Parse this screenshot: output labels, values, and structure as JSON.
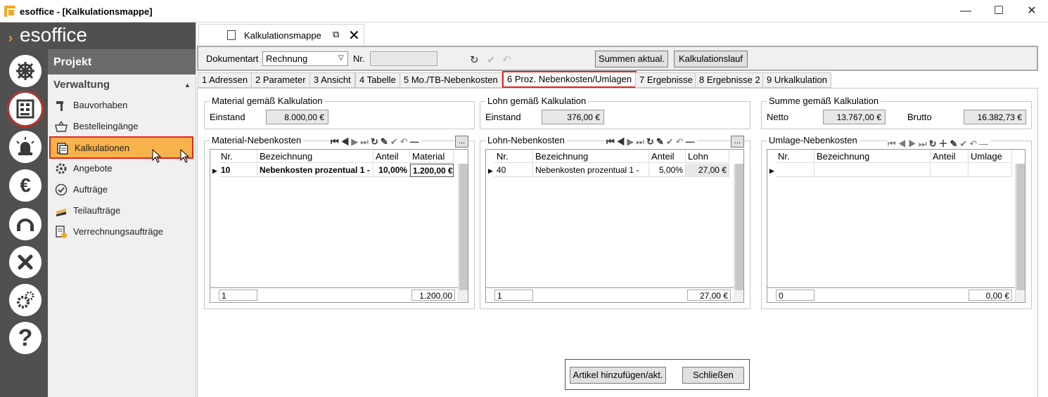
{
  "window": {
    "title": "esoffice - [Kalkulationsmappe]",
    "minimize": "—",
    "maximize": "☐",
    "close": "✕"
  },
  "brand": {
    "logo": "esoffice"
  },
  "sidebar": {
    "header": "Projekt",
    "section": "Verwaltung",
    "items": [
      {
        "label": "Bauvorhaben",
        "icon": "hammer-icon"
      },
      {
        "label": "Bestelleingänge",
        "icon": "basket-icon"
      },
      {
        "label": "Kalkulationen",
        "icon": "calculation-doc-icon",
        "active": true
      },
      {
        "label": "Angebote",
        "icon": "gear-icon"
      },
      {
        "label": "Aufträge",
        "icon": "check-circle-icon"
      },
      {
        "label": "Teilaufträge",
        "icon": "layers-icon"
      },
      {
        "label": "Verrechnungsaufträge",
        "icon": "doc-coin-icon"
      }
    ]
  },
  "doc_tab": {
    "label": "Kalkulationsmappe"
  },
  "toolbar": {
    "dokart_label": "Dokumentart",
    "dokart_value": "Rechnung",
    "nr_label": "Nr.",
    "nr_value": "",
    "summen_btn": "Summen aktual.",
    "lauf_btn": "Kalkulationslauf"
  },
  "tabs": [
    {
      "label": "1 Adressen"
    },
    {
      "label": "2 Parameter"
    },
    {
      "label": "3 Ansicht"
    },
    {
      "label": "4 Tabelle"
    },
    {
      "label": "5 Mo./TB-Nebenkosten"
    },
    {
      "label": "6 Proz. Nebenkosten/Umlagen",
      "active": true
    },
    {
      "label": "7 Ergebnisse"
    },
    {
      "label": "8 Ergebnisse 2"
    },
    {
      "label": "9 Urkalkulation"
    }
  ],
  "summary": {
    "material": {
      "title": "Material gemäß Kalkulation",
      "label": "Einstand",
      "value": "8.000,00 €"
    },
    "lohn": {
      "title": "Lohn gemäß Kalkulation",
      "label": "Einstand",
      "value": "376,00 €"
    },
    "summe": {
      "title": "Summe gemäß Kalkulation",
      "netto_label": "Netto",
      "netto_value": "13.767,00 €",
      "brutto_label": "Brutto",
      "brutto_value": "16.382,73 €"
    }
  },
  "material_grid": {
    "title": "Material-Nebenkosten",
    "more": "...",
    "headers": [
      "Nr.",
      "Bezeichnung",
      "Anteil",
      "Material"
    ],
    "row": [
      "10",
      "Nebenkosten prozentual 1 -",
      "10,00%",
      "1.200,00 €"
    ],
    "footer_count": "1",
    "footer_sum": "1.200,00"
  },
  "lohn_grid": {
    "title": "Lohn-Nebenkosten",
    "more": "...",
    "headers": [
      "Nr.",
      "Bezeichnung",
      "Anteil",
      "Lohn"
    ],
    "row": [
      "40",
      "Nebenkosten prozentual 1 -",
      "5,00%",
      "27,00 €"
    ],
    "footer_count": "1",
    "footer_sum": "27,00 €"
  },
  "umlage_grid": {
    "title": "Umlage-Nebenkosten",
    "headers": [
      "Nr.",
      "Bezeichnung",
      "Anteil",
      "Umlage"
    ],
    "footer_count": "0",
    "footer_sum": "0,00 €"
  },
  "actions": {
    "add": "Artikel hinzufügen/akt.",
    "close": "Schließen"
  }
}
